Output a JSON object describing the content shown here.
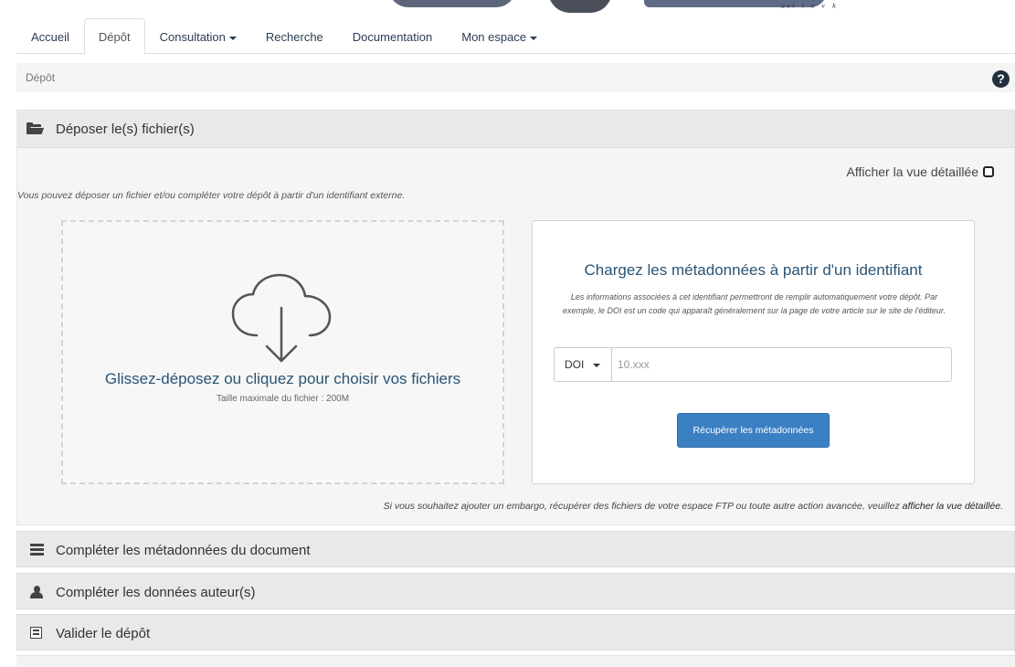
{
  "banner": {
    "scribble": "ᵃᵉᵗ ˡ ᵉ ᵛ ᵏ"
  },
  "nav": {
    "tabs": [
      {
        "label": "Accueil"
      },
      {
        "label": "Dépôt"
      },
      {
        "label": "Consultation"
      },
      {
        "label": "Recherche"
      },
      {
        "label": "Documentation"
      },
      {
        "label": "Mon espace"
      }
    ]
  },
  "breadcrumb": {
    "current": "Dépôt",
    "help_glyph": "?"
  },
  "deposit": {
    "title": "Déposer le(s) fichier(s)",
    "detail_toggle": "Afficher la vue détaillée",
    "intro": "Vous pouvez déposer un fichier et/ou compléter votre dépôt à partir d'un identifiant externe.",
    "dropzone": {
      "title": "Glissez-déposez ou cliquez pour choisir vos fichiers",
      "subtitle": "Taille maximale du fichier : 200M"
    },
    "metadata": {
      "title": "Chargez les métadonnées à partir d'un identifiant",
      "description": "Les informations associées à cet identifiant permettront de remplir automatiquement votre dépôt. Par exemple, le DOI est un code qui apparaît généralement sur la page de votre article sur le site de l'éditeur.",
      "id_type": "DOI",
      "id_placeholder": "10.xxx",
      "fetch_button": "Récupérer les métadonnées"
    },
    "embargo_text": "Si vous souhaitez ajouter un embargo, récupérer des fichiers de votre espace FTP ou toute autre action avancée, veuillez ",
    "embargo_link": "afficher la vue détaillée",
    "embargo_end": "."
  },
  "sections": {
    "metadata": "Compléter les métadonnées du document",
    "authors": "Compléter les données auteur(s)",
    "validate": "Valider le dépôt"
  }
}
